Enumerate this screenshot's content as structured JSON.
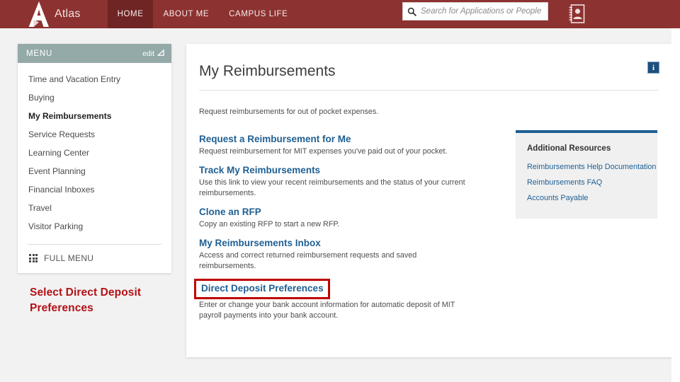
{
  "header": {
    "brand_name": "Atlas",
    "logo_icon": "atlas-a-logo",
    "nav": [
      {
        "label": "HOME",
        "active": true
      },
      {
        "label": "ABOUT ME",
        "active": false
      },
      {
        "label": "CAMPUS LIFE",
        "active": false
      }
    ],
    "search": {
      "placeholder": "Search for Applications or People",
      "value": "",
      "icon": "search-icon"
    },
    "address_book_icon": "address-book-icon",
    "bar_color": "#8c3230",
    "active_tab_color": "#6f2524"
  },
  "sidebar": {
    "title": "MENU",
    "edit_label": "edit",
    "edit_icon": "pencil-icon",
    "header_color": "#94aaa9",
    "items": [
      {
        "label": "Time and Vacation Entry",
        "active": false
      },
      {
        "label": "Buying",
        "active": false
      },
      {
        "label": "My Reimbursements",
        "active": true
      },
      {
        "label": "Service Requests",
        "active": false
      },
      {
        "label": "Learning Center",
        "active": false
      },
      {
        "label": "Event Planning",
        "active": false
      },
      {
        "label": "Financial Inboxes",
        "active": false
      },
      {
        "label": "Travel",
        "active": false
      },
      {
        "label": "Visitor Parking",
        "active": false
      }
    ],
    "full_menu_label": "FULL MENU",
    "full_menu_icon": "grid-icon"
  },
  "annotation": {
    "text": "Select Direct Deposit Preferences",
    "color": "#b21116"
  },
  "main": {
    "title": "My Reimbursements",
    "info_icon": "info-icon",
    "info_glyph": "i",
    "intro": "Request reimbursements for out of pocket expenses.",
    "links": [
      {
        "title": "Request a Reimbursement for Me",
        "desc": "Request reimbursement for MIT expenses you've paid out of your pocket.",
        "highlighted": false
      },
      {
        "title": "Track My Reimbursements",
        "desc": "Use this link to view your recent reimbursements and the status of your current reimbursements.",
        "highlighted": false
      },
      {
        "title": "Clone an RFP",
        "desc": "Copy an existing RFP to start a new RFP.",
        "highlighted": false
      },
      {
        "title": "My Reimbursements Inbox",
        "desc": "Access and correct returned reimbursement requests and saved reimbursements.",
        "highlighted": false
      },
      {
        "title": "Direct Deposit Preferences",
        "desc": "Enter or change your bank account information for automatic deposit of MIT payroll payments into your bank account.",
        "highlighted": true
      }
    ],
    "link_color": "#1f5f93",
    "highlight_color": "#c00000"
  },
  "resources": {
    "title": "Additional Resources",
    "accent_color": "#1f5f93",
    "links": [
      {
        "label": "Reimbursements Help Documentation"
      },
      {
        "label": "Reimbursements FAQ"
      },
      {
        "label": "Accounts Payable"
      }
    ]
  }
}
